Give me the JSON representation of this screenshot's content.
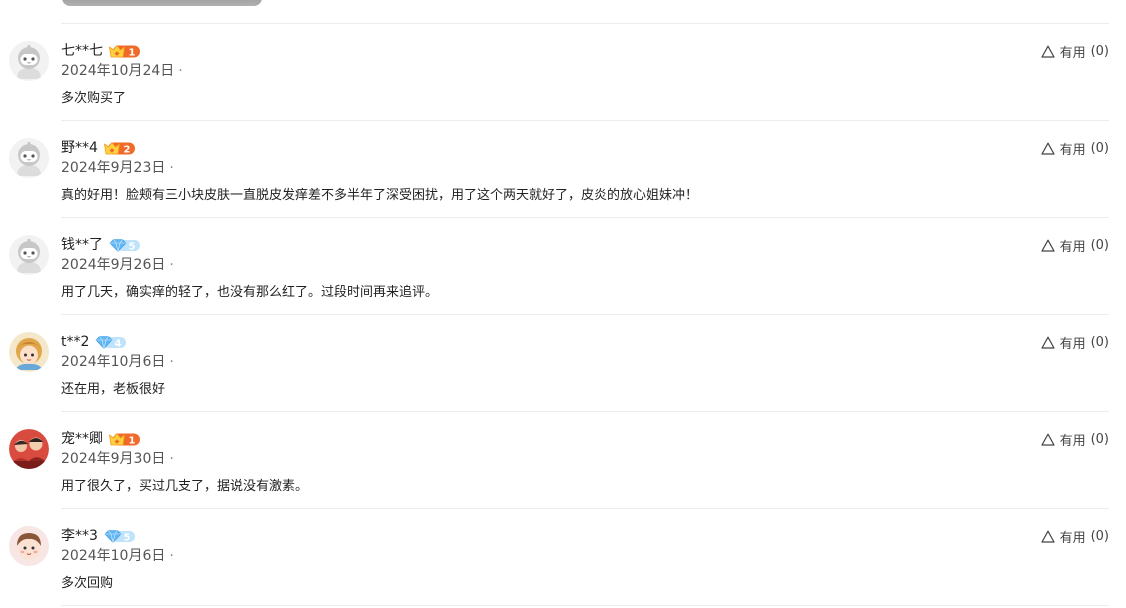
{
  "helpful": {
    "label": "有用",
    "count": "(0)"
  },
  "date_separator": "·",
  "colors": {
    "crown_badge": "#f06a2a",
    "diamond_badge": "#62b6f3",
    "divider": "#ececec"
  },
  "reviews": [
    {
      "username": "七**七",
      "badge_type": "crown",
      "badge_level": "1",
      "date": "2024年10月24日",
      "text": "多次购买了",
      "avatar": "default-robot-avatar"
    },
    {
      "username": "野**4",
      "badge_type": "crown",
      "badge_level": "2",
      "date": "2024年9月23日",
      "text": "真的好用！脸颊有三小块皮肤一直脱皮发痒差不多半年了深受困扰，用了这个两天就好了，皮炎的放心姐妹冲！",
      "avatar": "default-robot-avatar"
    },
    {
      "username": "钱**了",
      "badge_type": "diamond",
      "badge_level": "5",
      "date": "2024年9月26日",
      "text": "用了几天，确实痒的轻了，也没有那么红了。过段时间再来追评。",
      "avatar": "default-robot-avatar"
    },
    {
      "username": "t**2",
      "badge_type": "diamond",
      "badge_level": "4",
      "date": "2024年10月6日",
      "text": "还在用，老板很好",
      "avatar": "cartoon-girl-avatar"
    },
    {
      "username": "宠**卿",
      "badge_type": "crown",
      "badge_level": "1",
      "date": "2024年9月30日",
      "text": "用了很久了，买过几支了，据说没有激素。",
      "avatar": "photo-avatar"
    },
    {
      "username": "李**3",
      "badge_type": "diamond",
      "badge_level": "5",
      "date": "2024年10月6日",
      "text": "多次回购",
      "avatar": "cartoon-avatar"
    }
  ]
}
